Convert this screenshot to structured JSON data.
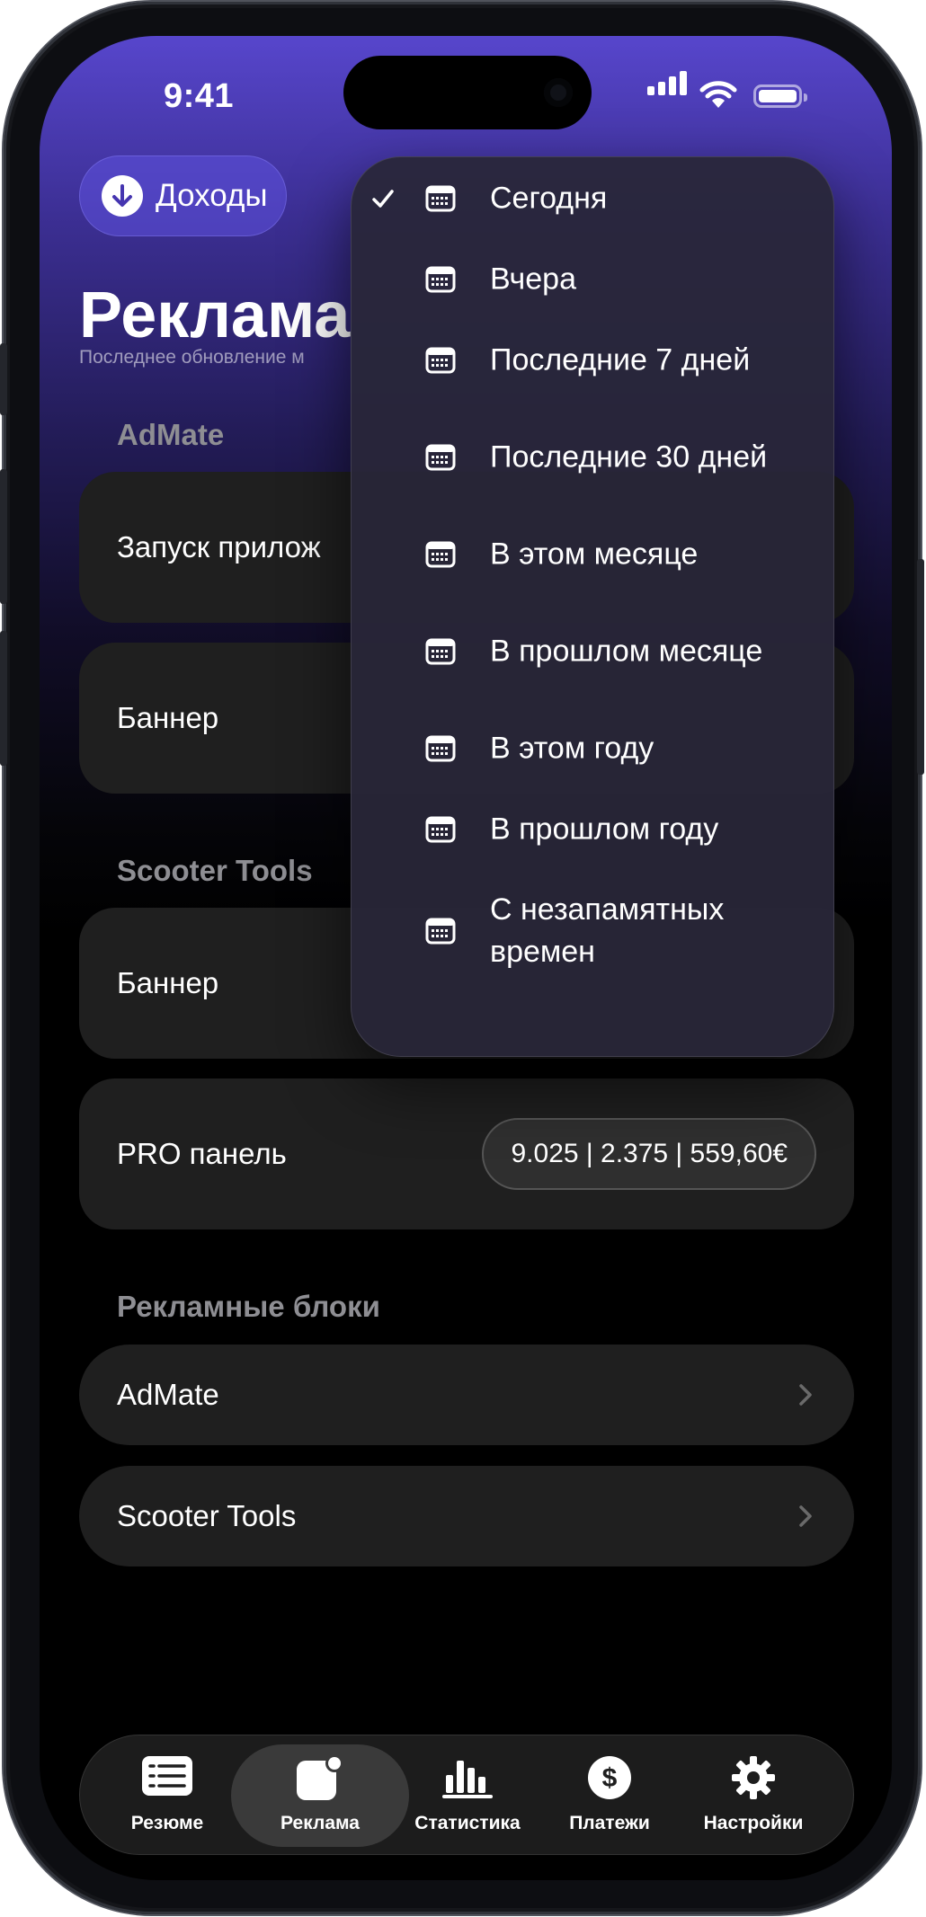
{
  "status_bar": {
    "time": "9:41"
  },
  "header": {
    "income_button": {
      "label": "Доходы",
      "icon": "arrow-down-circle-icon"
    },
    "title": "Реклама",
    "subtitle": "Последнее обновление м"
  },
  "sections": [
    {
      "title": "AdMate",
      "rows": [
        {
          "label": "Запуск прилож"
        },
        {
          "label": "Баннер"
        }
      ]
    },
    {
      "title": "Scooter Tools",
      "rows": [
        {
          "label": "Баннер"
        },
        {
          "label": "PRO панель",
          "value": "9.025 | 2.375 | 559,60€"
        }
      ]
    },
    {
      "title": "Рекламные блоки",
      "rows": [
        {
          "label": "AdMate"
        },
        {
          "label": "Scooter Tools"
        }
      ]
    }
  ],
  "date_menu": {
    "selected": "Сегодня",
    "items": [
      {
        "label": "Сегодня"
      },
      {
        "label": "Вчера"
      },
      {
        "label": "Последние 7 дней"
      },
      {
        "label": "Последние 30 дней"
      },
      {
        "label": "В этом месяце"
      },
      {
        "label": "В прошлом месяце"
      },
      {
        "label": "В этом году"
      },
      {
        "label": "В прошлом году"
      },
      {
        "label": "С незапамятных времен"
      }
    ]
  },
  "tab_bar": {
    "active": "Реклама",
    "tabs": [
      {
        "label": "Резюме",
        "icon": "list-icon"
      },
      {
        "label": "Реклама",
        "icon": "app-badge-icon"
      },
      {
        "label": "Статистика",
        "icon": "bar-chart-icon"
      },
      {
        "label": "Платежи",
        "icon": "dollar-circle-icon"
      },
      {
        "label": "Настройки",
        "icon": "gear-icon"
      }
    ]
  }
}
